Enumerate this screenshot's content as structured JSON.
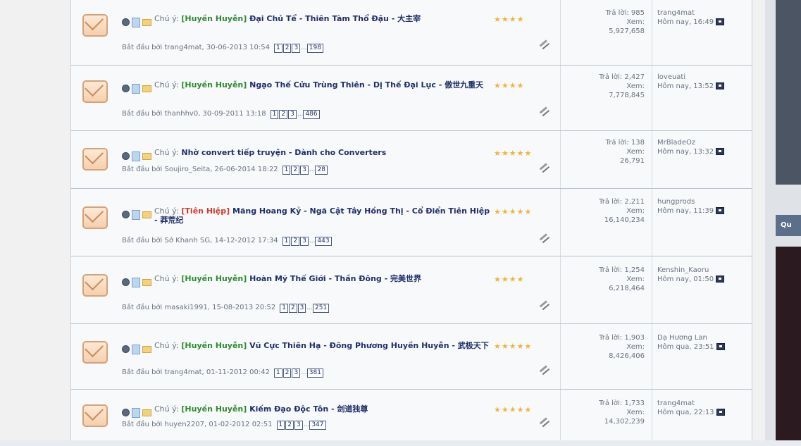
{
  "threads": [
    {
      "chu_y": "Chú ý:",
      "prefix": "[Huyền Huyễn]",
      "prefix_color": "green",
      "title": "Đại Chủ Tể - Thiên Tàm Thổ Đậu - 大主宰",
      "byline": "Bắt đầu bởi trang4mat, 30-06-2013 10:54",
      "pages": [
        "1",
        "2",
        "3"
      ],
      "last_page": "198",
      "stars": "★★★★",
      "reply_label": "Trả lời: 985",
      "view_label": "Xem:",
      "views": "5,927,658",
      "last_user": "trang4mat",
      "last_time": "Hôm nay, 16:49"
    },
    {
      "chu_y": "Chú ý:",
      "prefix": "[Huyền Huyễn]",
      "prefix_color": "green",
      "title": "Ngạo Thế Cửu Trùng Thiên - Dị Thế Đại Lục - 傲世九重天",
      "byline": "Bắt đầu bởi thanhhv0, 30-09-2011 13:18",
      "pages": [
        "1",
        "2",
        "3"
      ],
      "last_page": "486",
      "stars": "★★★★",
      "reply_label": "Trả lời: 2,427",
      "view_label": "Xem:",
      "views": "7,778,845",
      "last_user": "loveuati",
      "last_time": "Hôm nay, 13:52"
    },
    {
      "chu_y": "Chú ý:",
      "prefix": "",
      "prefix_color": "green",
      "title": "Nhờ convert tiếp truyện - Dành cho Converters",
      "byline": "Bắt đầu bởi Soujiro_Seita, 26-06-2014 18:22",
      "pages": [
        "1",
        "2",
        "3"
      ],
      "last_page": "28",
      "stars": "★★★★★",
      "reply_label": "Trả lời: 138",
      "view_label": "Xem:",
      "views": "26,791",
      "last_user": "MrBladeOz",
      "last_time": "Hôm nay, 13:32"
    },
    {
      "chu_y": "Chú ý:",
      "prefix": "[Tiên Hiệp]",
      "prefix_color": "red",
      "title": "Mãng Hoang Kỷ - Ngã Cật Tây Hồng Thị - Cổ Điển Tiên Hiệp - 莽荒纪",
      "byline": "Bắt đầu bởi Sở Khanh SG, 14-12-2012 17:34",
      "pages": [
        "1",
        "2",
        "3"
      ],
      "last_page": "443",
      "stars": "★★★★★",
      "reply_label": "Trả lời: 2,211",
      "view_label": "Xem:",
      "views": "16,140,234",
      "last_user": "hungprods",
      "last_time": "Hôm nay, 11:39"
    },
    {
      "chu_y": "Chú ý:",
      "prefix": "[Huyền Huyễn]",
      "prefix_color": "green",
      "title": "Hoàn Mỹ Thế Giới - Thần Đông - 完美世界",
      "byline": "Bắt đầu bởi masaki1991, 15-08-2013 20:52",
      "pages": [
        "1",
        "2",
        "3"
      ],
      "last_page": "251",
      "stars": "★★★★",
      "reply_label": "Trả lời: 1,254",
      "view_label": "Xem:",
      "views": "6,218,464",
      "last_user": "Kenshin_Kaoru",
      "last_time": "Hôm nay, 01:50"
    },
    {
      "chu_y": "Chú ý:",
      "prefix": "[Huyền Huyễn]",
      "prefix_color": "green",
      "title": "Vũ Cực Thiên Hạ - Đông Phương Huyền Huyễn - 武极天下",
      "byline": "Bắt đầu bởi trang4mat, 01-11-2012 00:42",
      "pages": [
        "1",
        "2",
        "3"
      ],
      "last_page": "381",
      "stars": "★★★★★",
      "reply_label": "Trả lời: 1,903",
      "view_label": "Xem:",
      "views": "8,426,406",
      "last_user": "Dạ Hương Lan",
      "last_time": "Hôm qua, 23:51"
    },
    {
      "chu_y": "Chú ý:",
      "prefix": "[Huyền Huyễn]",
      "prefix_color": "green",
      "title": "Kiếm Đạo Độc Tôn - 剑道独尊",
      "byline": "Bắt đầu bởi huyen2207, 01-02-2012 02:51",
      "pages": [
        "1",
        "2",
        "3"
      ],
      "last_page": "347",
      "stars": "★★★★★",
      "reply_label": "Trả lời: 1,733",
      "view_label": "Xem:",
      "views": "14,302,239",
      "last_user": "trang4mat",
      "last_time": "Hôm qua, 22:13"
    }
  ],
  "sidebar": {
    "heading_fragment": "Qu"
  },
  "colors": {
    "title": "#1f2f6b",
    "prefix_green": "#2f8a2f",
    "prefix_red": "#d03a2a",
    "stars": "#f2b33a"
  },
  "icons": [
    "envelope-icon",
    "status-dot-icon",
    "document-icon",
    "folder-icon",
    "pencil-icon",
    "goto-last-post-icon",
    "star-icon"
  ]
}
